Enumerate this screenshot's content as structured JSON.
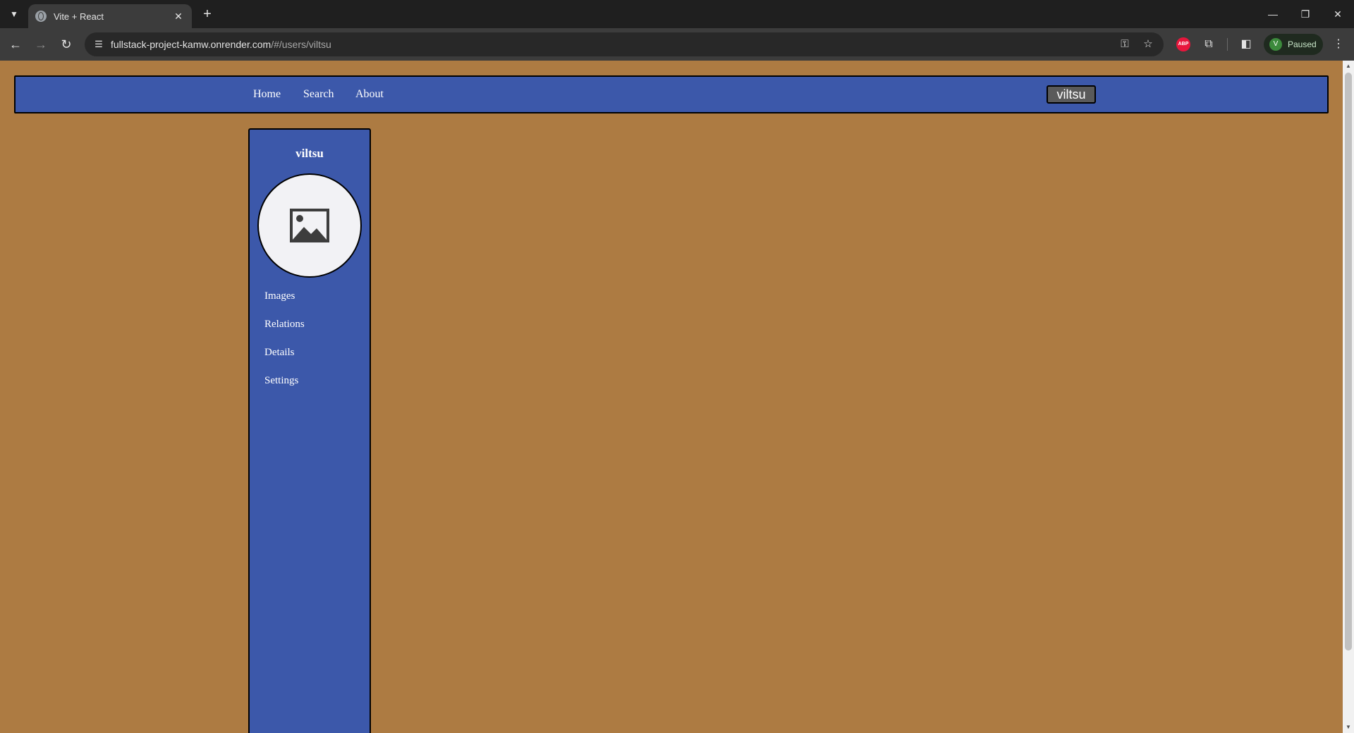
{
  "browser": {
    "tab": {
      "title": "Vite + React"
    },
    "address": {
      "host": "fullstack-project-kamw.onrender.com",
      "path": "/#/users/viltsu"
    },
    "profile": {
      "initial": "V",
      "status": "Paused"
    },
    "extensions": {
      "abp_label": "ABP"
    }
  },
  "navbar": {
    "links": [
      {
        "label": "Home"
      },
      {
        "label": "Search"
      },
      {
        "label": "About"
      }
    ],
    "user_button": "viltsu"
  },
  "sidebar": {
    "username": "viltsu",
    "links": [
      {
        "label": "Images"
      },
      {
        "label": "Relations"
      },
      {
        "label": "Details"
      },
      {
        "label": "Settings"
      }
    ]
  },
  "colors": {
    "page_background": "#ad7b42",
    "nav_blue": "#3c58aa",
    "avatar_background": "#f2f2f5"
  }
}
